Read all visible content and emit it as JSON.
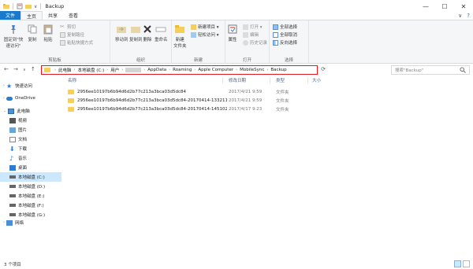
{
  "window": {
    "title": "Backup",
    "controls": [
      "—",
      "☐",
      "✕"
    ]
  },
  "ribbon_tabs": {
    "file": "文件",
    "home": "主页",
    "share": "共享",
    "view": "查看"
  },
  "ribbon": {
    "pin_quick": "固定到\"快\n速访问\"",
    "copy": "复制",
    "paste": "粘贴",
    "cut": "剪切",
    "copy_path": "复制路径",
    "paste_shortcut": "粘贴快捷方式",
    "clipboard_label": "剪贴板",
    "move_to": "移动到",
    "copy_to": "复制到",
    "delete": "删除",
    "rename": "重命名",
    "organize_label": "组织",
    "new_folder": "新建\n文件夹",
    "new_item": "新建项目 ▾",
    "easy_access": "轻松访问 ▾",
    "new_label": "新建",
    "properties": "属性",
    "open": "打开 ▾",
    "edit": "编辑",
    "history": "历史记录",
    "open_label": "打开",
    "select_all": "全部选择",
    "select_none": "全部取消",
    "invert_selection": "反向选择",
    "select_label": "选择"
  },
  "address": {
    "crumbs": [
      "此电脑",
      "本地磁盘 (C:)",
      "用户",
      "AppData",
      "Roaming",
      "Apple Computer",
      "MobileSync",
      "Backup"
    ]
  },
  "search": {
    "placeholder": "搜索\"Backup\""
  },
  "nav": {
    "quick_access": "快速访问",
    "onedrive": "OneDrive",
    "this_pc": "此电脑",
    "videos": "视频",
    "pictures": "图片",
    "documents": "文档",
    "downloads": "下载",
    "music": "音乐",
    "desktop": "桌面",
    "drive_c": "本地磁盘 (C:)",
    "drive_d": "本地磁盘 (D:)",
    "drive_e": "本地磁盘 (E:)",
    "drive_f": "本地磁盘 (F:)",
    "drive_g": "本地磁盘 (G:)",
    "network": "网络"
  },
  "columns": {
    "name": "名称",
    "date": "修改日期",
    "type": "类型",
    "size": "大小"
  },
  "files": [
    {
      "name": "2956ee10197b6b94d6d2b77c213a3bca03d5dc84",
      "date": "2017/4/21 9:59",
      "type": "文件夹"
    },
    {
      "name": "2956ee10197b6b94d6d2b77c213a3bca03d5dc84-20170414-133211",
      "date": "2017/4/21 9:59",
      "type": "文件夹"
    },
    {
      "name": "2956ee10197b6b94d6d2b77c213a3bca03d5dc84-20170414-145102",
      "date": "2017/4/17 9:23",
      "type": "文件夹"
    }
  ],
  "status": {
    "item_count": "3 个项目"
  },
  "colors": {
    "accent": "#1979ca",
    "folder": "#f6cf5a",
    "highlight": "#e01b24",
    "selection": "#cce8ff"
  }
}
